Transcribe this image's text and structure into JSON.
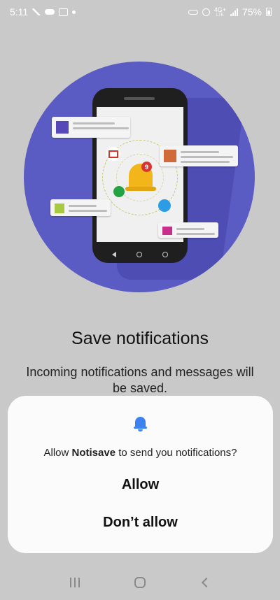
{
  "status_bar": {
    "time": "5:11",
    "network_type": "4G+",
    "network_sub": "LTE",
    "battery": "75%"
  },
  "hero": {
    "bell_badge": "9"
  },
  "main": {
    "title": "Save notifications",
    "subtitle": "Incoming notifications and messages will be saved."
  },
  "dialog": {
    "message_prefix": "Allow ",
    "app_name": "Notisave",
    "message_suffix": " to send you notifications?",
    "allow_label": "Allow",
    "deny_label": "Don’t allow"
  },
  "colors": {
    "hero_circle": "#5b5bc4",
    "dialog_bell": "#3b82f0",
    "background": "#c9c9c9"
  },
  "icons": {
    "dialog": "bell-icon",
    "nav_recent": "recent-apps-icon",
    "nav_home": "home-icon",
    "nav_back": "back-icon"
  }
}
